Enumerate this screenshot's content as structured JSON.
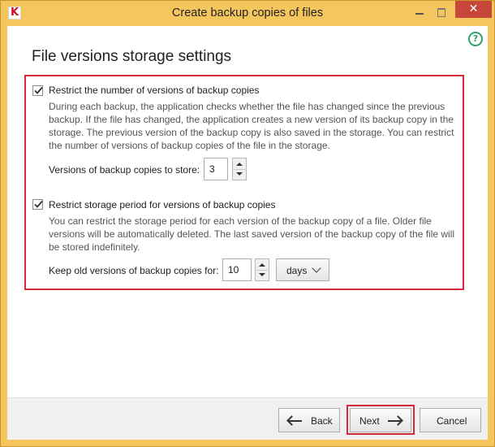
{
  "window": {
    "title": "Create backup copies of files",
    "app_icon_glyph": "K",
    "close_glyph": "✕",
    "help_glyph": "?"
  },
  "page": {
    "title": "File versions storage settings"
  },
  "versions": {
    "checkbox_label": "Restrict the number of versions of backup copies",
    "checked": true,
    "description_lines": [
      "During each backup, the application checks whether the file has changed since the previous",
      "backup. If the file has changed, the application creates a new version of its backup copy in the",
      "storage. The previous version of the backup copy is also saved in the storage. You can restrict",
      "the number of versions of backup copies of the file in the storage."
    ],
    "input_label": "Versions of backup copies to store:",
    "input_value": "3"
  },
  "period": {
    "checkbox_label": "Restrict storage period for versions of backup copies",
    "checked": true,
    "description_lines": [
      "You can restrict the storage period for each version of the backup copy of a file. Older file",
      "versions will be automatically deleted. The last saved version of the backup copy of the file will",
      "be stored indefinitely."
    ],
    "input_label": "Keep old versions of backup copies for:",
    "input_value": "10",
    "unit_selected": "days"
  },
  "footer": {
    "back_label": "Back",
    "next_label": "Next",
    "cancel_label": "Cancel"
  },
  "colors": {
    "title_bar": "#f5c55e",
    "close_button": "#c7473b",
    "highlight": "#d42a3a",
    "help": "#2fa36b"
  }
}
